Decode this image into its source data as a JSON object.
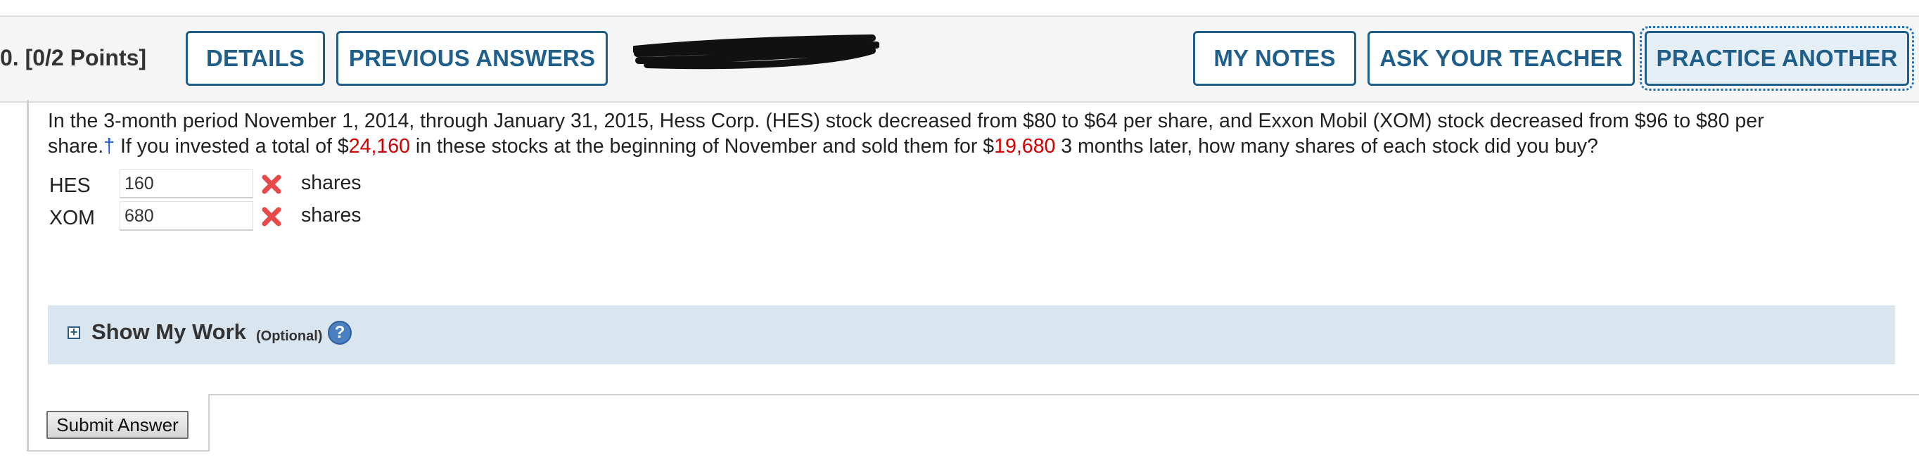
{
  "header": {
    "question_points": "0.  [0/2 Points]",
    "buttons": {
      "details": "DETAILS",
      "previous_answers": "PREVIOUS ANSWERS",
      "my_notes": "MY NOTES",
      "ask_your_teacher": "ASK YOUR TEACHER",
      "practice_another": "PRACTICE ANOTHER"
    }
  },
  "question": {
    "line1": "In the 3-month period November 1, 2014, through January 31, 2015, Hess Corp. (HES) stock decreased from $80 to $64 per share, and Exxon Mobil (XOM) stock decreased from $96 to $80 per",
    "line2_a": "share.",
    "dagger": "†",
    "line2_b": " If you invested a total of $",
    "total_invested": "24,160",
    "line2_c": " in these stocks at the beginning of November and sold them for $",
    "total_sold": "19,680",
    "line2_d": " 3 months later, how many shares of each stock did you buy?"
  },
  "answers": [
    {
      "label": "HES",
      "value": "160",
      "unit": "shares",
      "status": "incorrect"
    },
    {
      "label": "XOM",
      "value": "680",
      "unit": "shares",
      "status": "incorrect"
    }
  ],
  "show_my_work": {
    "title": "Show My Work",
    "subtitle": "(Optional)",
    "help": "?"
  },
  "submit_label": "Submit Answer",
  "icons": {
    "incorrect": "x-mark-icon",
    "expand": "plus-box-icon",
    "help": "help-icon"
  },
  "colors": {
    "accent": "#1f5f8b",
    "error": "#e84a4a",
    "highlight": "#d40000",
    "work_bar": "#dae6ef"
  }
}
